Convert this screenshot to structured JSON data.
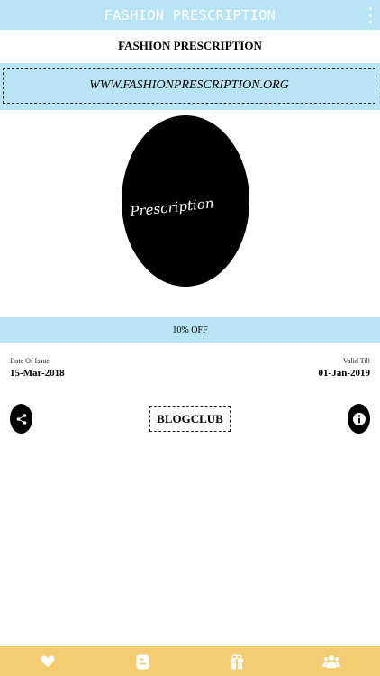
{
  "app": {
    "title": "FASHION PRESCRIPTION"
  },
  "store": {
    "name": "FASHION PRESCRIPTION",
    "url": "WWW.FASHIONPRESCRIPTION.ORG",
    "logo_text": "Prescription"
  },
  "offer": {
    "text": "10% OFF"
  },
  "dates": {
    "issue_label": "Date Of Issue",
    "issue_value": "15-Mar-2018",
    "valid_label": "Valid Till",
    "valid_value": "01-Jan-2019"
  },
  "coupon": {
    "code": "BLOGCLUB"
  },
  "colors": {
    "accent": "#b8e4f5",
    "bottom_bar": "#f4cc72"
  },
  "icons": {
    "menu": "more-vertical-icon",
    "share": "share-icon",
    "info": "info-icon",
    "bottom": [
      "heart-icon",
      "blogger-icon",
      "gift-icon",
      "group-icon"
    ]
  }
}
